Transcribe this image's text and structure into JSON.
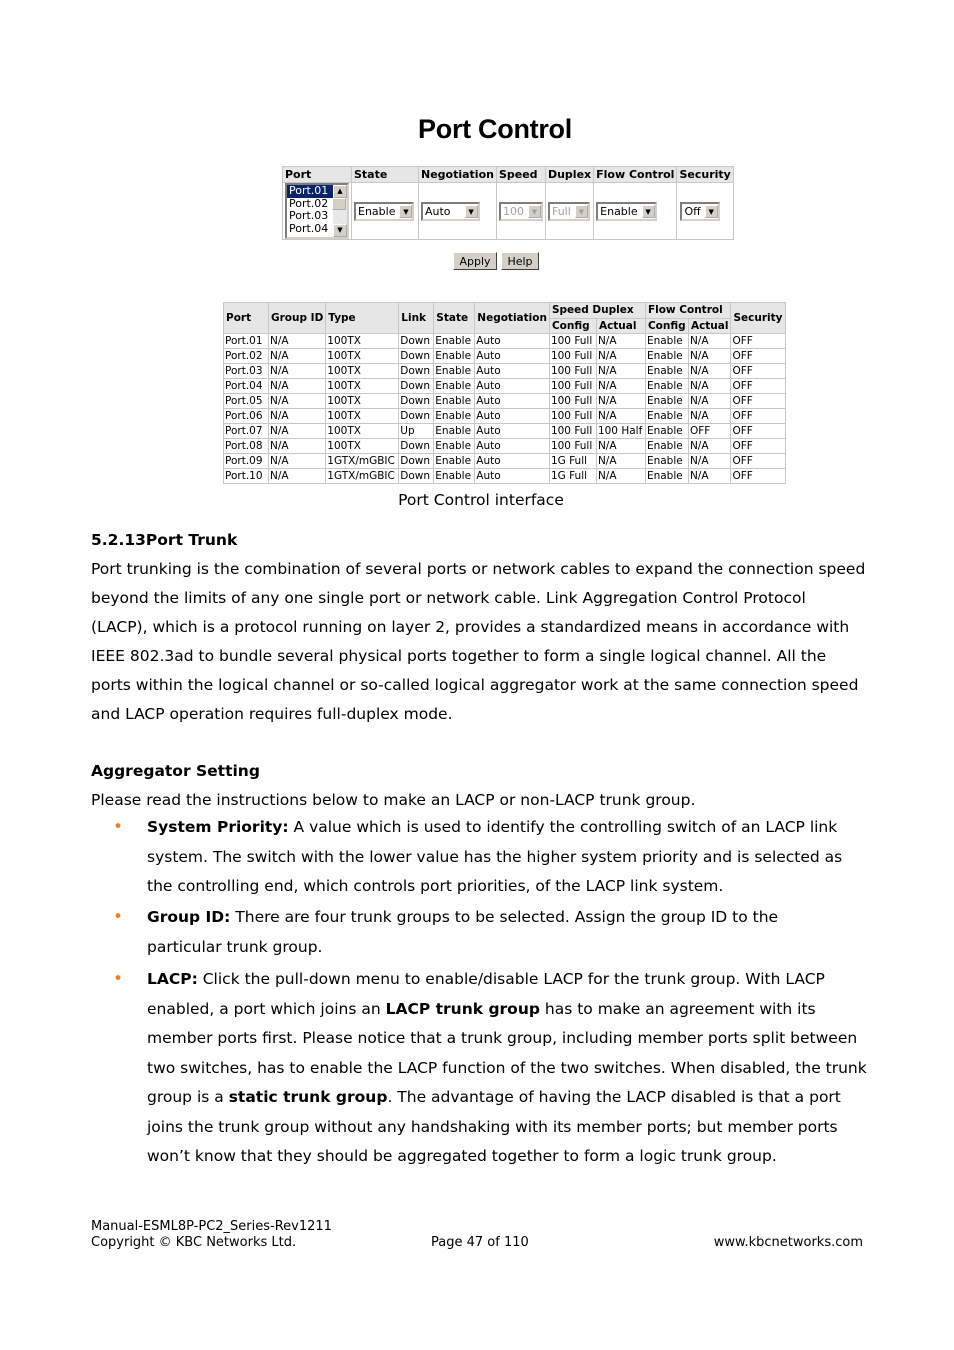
{
  "ui": {
    "title": "Port Control",
    "form": {
      "headers": [
        "Port",
        "State",
        "Negotiation",
        "Speed",
        "Duplex",
        "Flow Control",
        "Security"
      ],
      "port_list": [
        "Port.01",
        "Port.02",
        "Port.03",
        "Port.04"
      ],
      "selected_port": "Port.01",
      "state": "Enable",
      "negotiation": "Auto",
      "speed": "100",
      "duplex": "Full",
      "flow_control": "Enable",
      "security": "Off"
    },
    "buttons": {
      "apply": "Apply",
      "help": "Help"
    },
    "status_table": {
      "headers": {
        "port": "Port",
        "group_id": "Group ID",
        "type": "Type",
        "link": "Link",
        "state": "State",
        "negotiation": "Negotiation",
        "speed_duplex": "Speed Duplex",
        "flow_control": "Flow Control",
        "security": "Security",
        "config": "Config",
        "actual": "Actual"
      },
      "rows": [
        [
          "Port.01",
          "N/A",
          "100TX",
          "Down",
          "Enable",
          "Auto",
          "100 Full",
          "N/A",
          "Enable",
          "N/A",
          "OFF"
        ],
        [
          "Port.02",
          "N/A",
          "100TX",
          "Down",
          "Enable",
          "Auto",
          "100 Full",
          "N/A",
          "Enable",
          "N/A",
          "OFF"
        ],
        [
          "Port.03",
          "N/A",
          "100TX",
          "Down",
          "Enable",
          "Auto",
          "100 Full",
          "N/A",
          "Enable",
          "N/A",
          "OFF"
        ],
        [
          "Port.04",
          "N/A",
          "100TX",
          "Down",
          "Enable",
          "Auto",
          "100 Full",
          "N/A",
          "Enable",
          "N/A",
          "OFF"
        ],
        [
          "Port.05",
          "N/A",
          "100TX",
          "Down",
          "Enable",
          "Auto",
          "100 Full",
          "N/A",
          "Enable",
          "N/A",
          "OFF"
        ],
        [
          "Port.06",
          "N/A",
          "100TX",
          "Down",
          "Enable",
          "Auto",
          "100 Full",
          "N/A",
          "Enable",
          "N/A",
          "OFF"
        ],
        [
          "Port.07",
          "N/A",
          "100TX",
          "Up",
          "Enable",
          "Auto",
          "100 Full",
          "100 Half",
          "Enable",
          "OFF",
          "OFF"
        ],
        [
          "Port.08",
          "N/A",
          "100TX",
          "Down",
          "Enable",
          "Auto",
          "100 Full",
          "N/A",
          "Enable",
          "N/A",
          "OFF"
        ],
        [
          "Port.09",
          "N/A",
          "1GTX/mGBIC",
          "Down",
          "Enable",
          "Auto",
          "1G Full",
          "N/A",
          "Enable",
          "N/A",
          "OFF"
        ],
        [
          "Port.10",
          "N/A",
          "1GTX/mGBIC",
          "Down",
          "Enable",
          "Auto",
          "1G Full",
          "N/A",
          "Enable",
          "N/A",
          "OFF"
        ]
      ]
    }
  },
  "caption": "Port Control interface",
  "section": {
    "heading": "5.2.13Port Trunk",
    "paragraph": "Port trunking is the combination of several ports or network cables to expand the connection speed beyond the limits of any one single port or network cable. Link Aggregation Control Protocol (LACP), which is a protocol running on layer 2, provides a standardized means in accordance with IEEE 802.3ad to bundle several physical ports together to form a single logical channel. All the ports within the logical channel or so-called logical aggregator work at the same connection speed and LACP operation requires full-duplex mode.",
    "subheading": "Aggregator Setting",
    "intro": "Please read the instructions below to make an LACP or non-LACP trunk group.",
    "bullets": [
      {
        "label": "System Priority:",
        "text": " A value which is used to identify the controlling switch of an LACP link system. The switch with the lower value has the higher system priority and is selected as the controlling end, which controls port priorities, of the LACP link system."
      },
      {
        "label": "Group ID:",
        "text": " There are four trunk groups to be selected. Assign the group ID to the particular trunk group."
      },
      {
        "label": "LACP:",
        "text_a": " Click the pull-down menu to enable/disable LACP for the trunk group. With LACP enabled, a port which joins an ",
        "bold_a": "LACP trunk group",
        "text_b": " has to make an agreement with its member ports first. Please notice that a trunk group, including member ports split between two switches, has to enable the LACP function of the two switches. When disabled, the trunk group is a ",
        "bold_b": "static trunk group",
        "text_c": ". The advantage of having the LACP disabled is that a port joins the trunk group without any handshaking with its member ports; but member ports won’t know that they should be aggregated together to form a logic trunk group."
      }
    ]
  },
  "footer": {
    "manual": "Manual-ESML8P-PC2_Series-Rev1211",
    "copyright": "Copyright © KBC Networks Ltd.",
    "page": "Page 47 of 110",
    "website": "www.kbcnetworks.com"
  },
  "colors": {
    "bullet": "#f07f17",
    "selection": "#0a246a",
    "header_bg": "#e6e6e6"
  }
}
